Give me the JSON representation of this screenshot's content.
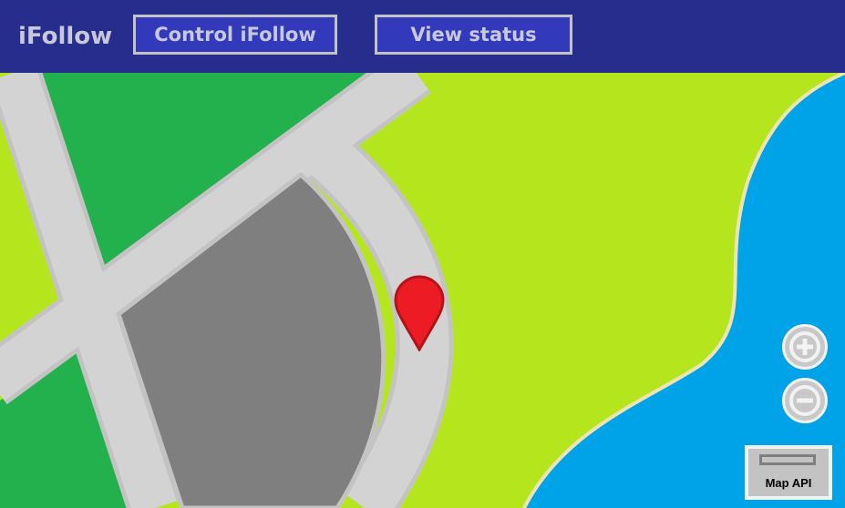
{
  "header": {
    "app_title": "iFollow",
    "control_label": "Control iFollow",
    "status_label": "View status"
  },
  "map": {
    "attribution": "Map API",
    "icons": {
      "zoom_in": "plus-icon",
      "zoom_out": "minus-icon",
      "pin": "location-pin-icon"
    }
  },
  "colors": {
    "header_bg": "#262d8c",
    "button_bg": "#3239ba",
    "button_border": "#c3c3c3",
    "grass": "#b5e61d",
    "park": "#22b14c",
    "water": "#00a2e8",
    "road": "#d3d3d3",
    "building": "#7f7f7f",
    "pin": "#ed1c24"
  }
}
